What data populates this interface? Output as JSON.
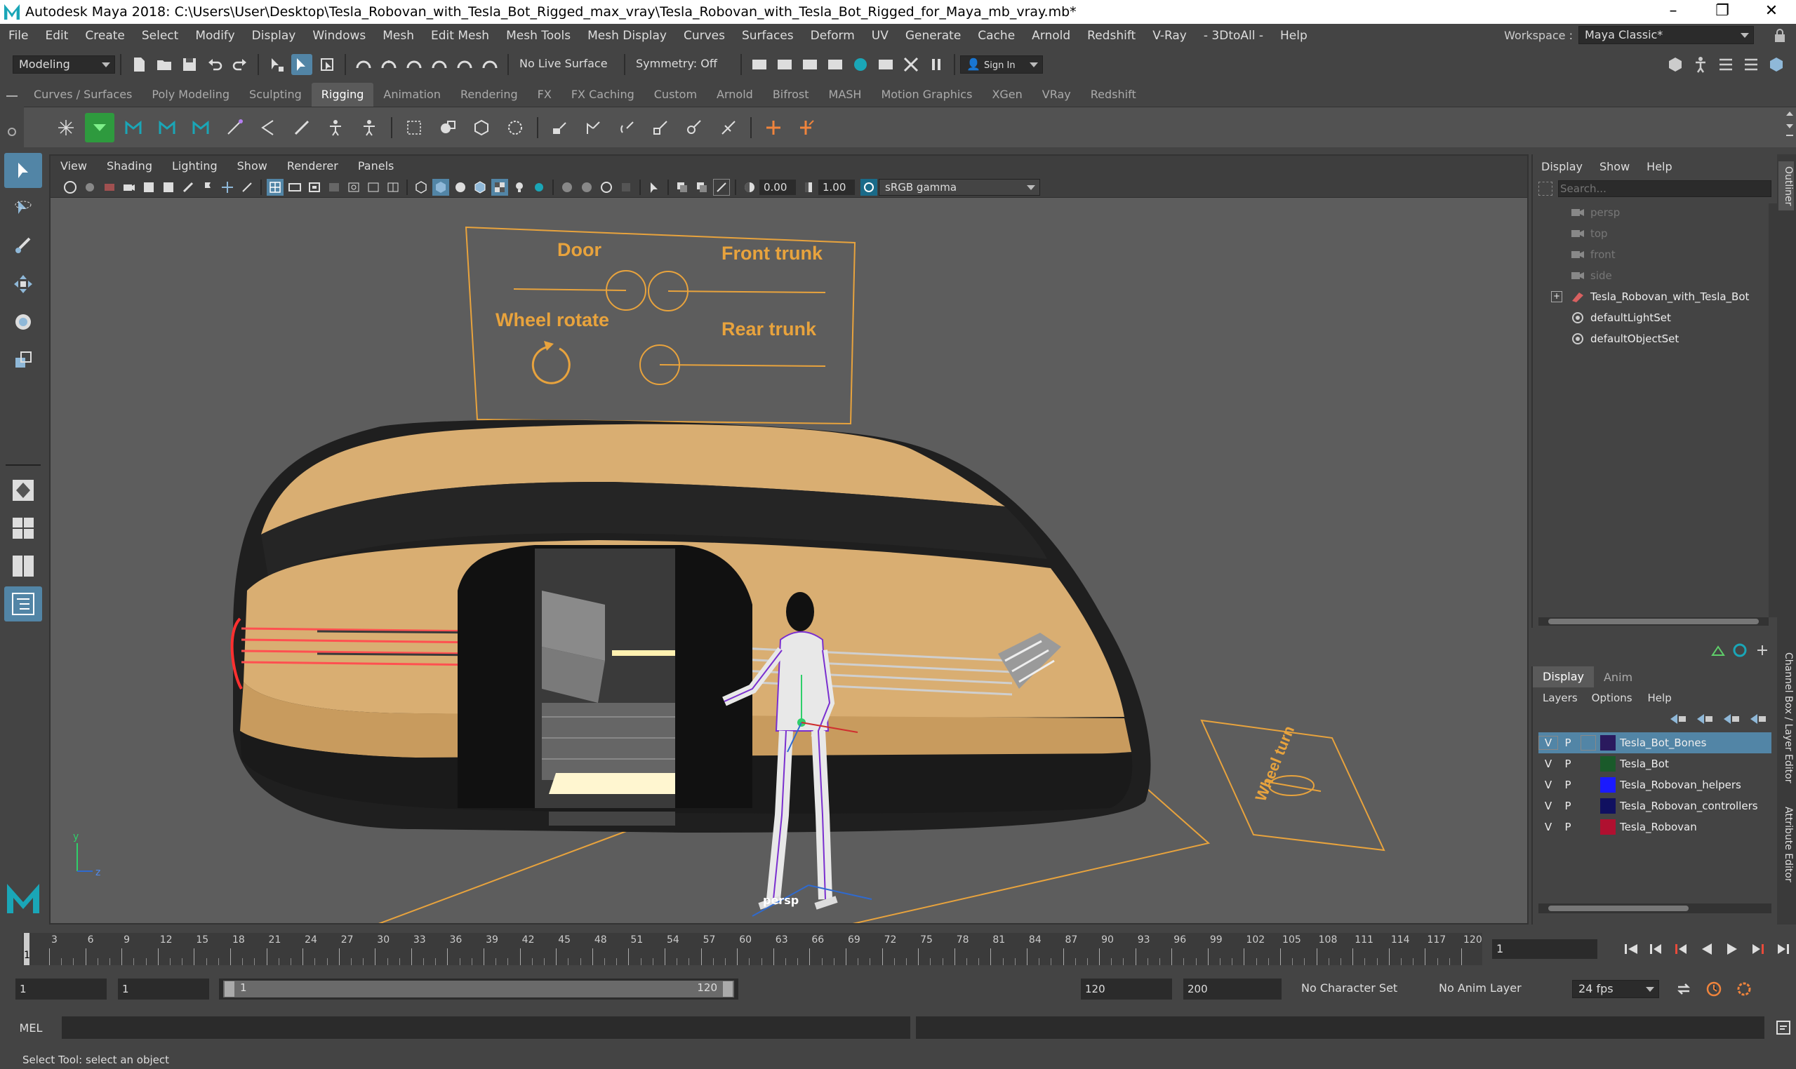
{
  "window": {
    "title": "Autodesk Maya 2018: C:\\Users\\User\\Desktop\\Tesla_Robovan_with_Tesla_Bot_Rigged_max_vray\\Tesla_Robovan_with_Tesla_Bot_Rigged_for_Maya_mb_vray.mb*"
  },
  "menubar": {
    "items": [
      "File",
      "Edit",
      "Create",
      "Select",
      "Modify",
      "Display",
      "Windows",
      "Mesh",
      "Edit Mesh",
      "Mesh Tools",
      "Mesh Display",
      "Curves",
      "Surfaces",
      "Deform",
      "UV",
      "Generate",
      "Cache",
      "Arnold",
      "Redshift",
      "V-Ray",
      "- 3DtoAll -",
      "Help"
    ],
    "workspace_label": "Workspace :",
    "workspace_value": "Maya Classic*"
  },
  "statusline": {
    "mode": "Modeling",
    "live_surface": "No Live Surface",
    "symmetry": "Symmetry: Off",
    "sign_in": "Sign In"
  },
  "shelf": {
    "tabs": [
      "Curves / Surfaces",
      "Poly Modeling",
      "Sculpting",
      "Rigging",
      "Animation",
      "Rendering",
      "FX",
      "FX Caching",
      "Custom",
      "Arnold",
      "Bifrost",
      "MASH",
      "Motion Graphics",
      "XGen",
      "VRay",
      "Redshift"
    ],
    "active_tab": "Rigging"
  },
  "viewport": {
    "menu": [
      "View",
      "Shading",
      "Lighting",
      "Show",
      "Renderer",
      "Panels"
    ],
    "exposure": "0.00",
    "gamma": "1.00",
    "color_space": "sRGB gamma",
    "camera": "persp",
    "controls": {
      "door": "Door",
      "front_trunk": "Front trunk",
      "wheel_rotate": "Wheel rotate",
      "rear_trunk": "Rear trunk",
      "wheel_turn": "Wheel turn"
    },
    "axis": {
      "y": "y",
      "z": "z"
    }
  },
  "outliner": {
    "menu": [
      "Display",
      "Show",
      "Help"
    ],
    "search_placeholder": "Search...",
    "items": [
      {
        "label": "persp",
        "type": "camera",
        "dim": true
      },
      {
        "label": "top",
        "type": "camera",
        "dim": true
      },
      {
        "label": "front",
        "type": "camera",
        "dim": true
      },
      {
        "label": "side",
        "type": "camera",
        "dim": true
      },
      {
        "label": "Tesla_Robovan_with_Tesla_Bot",
        "type": "group",
        "dim": false
      },
      {
        "label": "defaultLightSet",
        "type": "set",
        "dim": false
      },
      {
        "label": "defaultObjectSet",
        "type": "set",
        "dim": false
      }
    ],
    "side_tab": "Outliner"
  },
  "layers": {
    "tabs": [
      "Display",
      "Anim"
    ],
    "menu": [
      "Layers",
      "Options",
      "Help"
    ],
    "rows": [
      {
        "v": "V",
        "p": "P",
        "name": "Tesla_Bot_Bones",
        "color": "#2a1a5e",
        "selected": true
      },
      {
        "v": "V",
        "p": "P",
        "name": "Tesla_Bot",
        "color": "#1a5a2a",
        "selected": false
      },
      {
        "v": "V",
        "p": "P",
        "name": "Tesla_Robovan_helpers",
        "color": "#1a1aff",
        "selected": false
      },
      {
        "v": "V",
        "p": "P",
        "name": "Tesla_Robovan_controllers",
        "color": "#101060",
        "selected": false
      },
      {
        "v": "V",
        "p": "P",
        "name": "Tesla_Robovan",
        "color": "#b01030",
        "selected": false
      }
    ],
    "side_tabs": [
      "Channel Box / Layer Editor",
      "Attribute Editor"
    ]
  },
  "timeslider": {
    "ticks": [
      "3",
      "6",
      "9",
      "12",
      "15",
      "18",
      "21",
      "24",
      "27",
      "30",
      "33",
      "36",
      "39",
      "42",
      "45",
      "48",
      "51",
      "54",
      "57",
      "60",
      "63",
      "66",
      "69",
      "72",
      "75",
      "78",
      "81",
      "84",
      "87",
      "90",
      "93",
      "96",
      "99",
      "102",
      "105",
      "108",
      "111",
      "114",
      "117",
      "120"
    ],
    "current_frame": "1",
    "current_marker": "1"
  },
  "range": {
    "start": "1",
    "playback_start": "1",
    "slider_start": "1",
    "slider_end": "120",
    "playback_end": "120",
    "end": "200",
    "character_set": "No Character Set",
    "anim_layer": "No Anim Layer",
    "fps": "24 fps"
  },
  "cmdline": {
    "label": "MEL"
  },
  "helpline": {
    "text": "Select Tool: select an object"
  },
  "colors": {
    "accent": "#5285a6",
    "control": "#e8a33d",
    "body": "#d9ae72"
  }
}
